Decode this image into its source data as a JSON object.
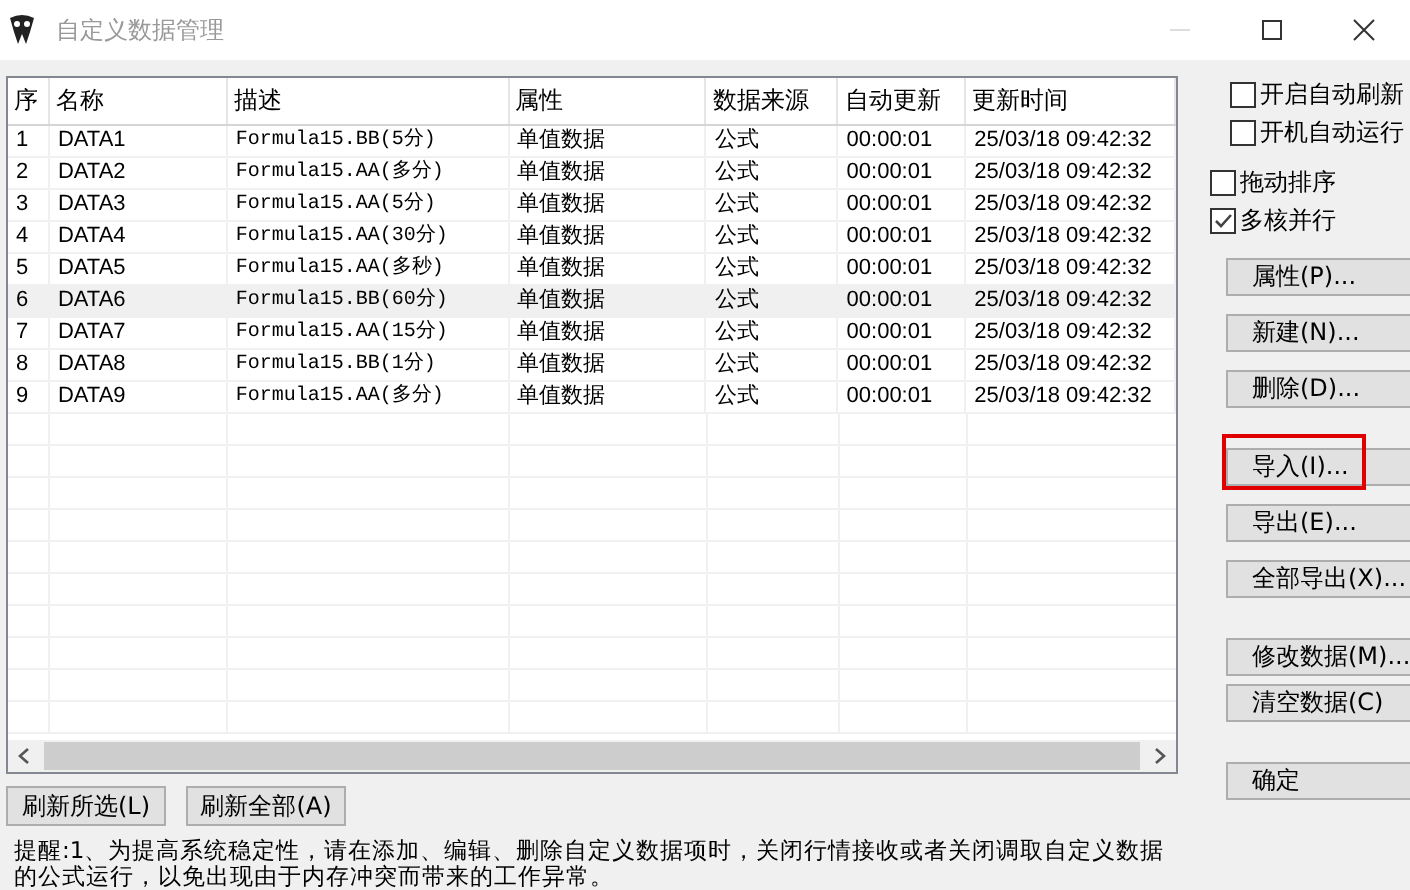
{
  "window": {
    "title": "自定义数据管理"
  },
  "table": {
    "columns": [
      "序",
      "名称",
      "描述",
      "属性",
      "数据来源",
      "自动更新",
      "更新时间"
    ],
    "rows": [
      {
        "cells": [
          "1",
          "DATA1",
          "Formula15.BB(5分)",
          "单值数据",
          "公式",
          "00:00:01",
          "25/03/18 09:42:32"
        ],
        "selected": false
      },
      {
        "cells": [
          "2",
          "DATA2",
          "Formula15.AA(多分)",
          "单值数据",
          "公式",
          "00:00:01",
          "25/03/18 09:42:32"
        ],
        "selected": false
      },
      {
        "cells": [
          "3",
          "DATA3",
          "Formula15.AA(5分)",
          "单值数据",
          "公式",
          "00:00:01",
          "25/03/18 09:42:32"
        ],
        "selected": false
      },
      {
        "cells": [
          "4",
          "DATA4",
          "Formula15.AA(30分)",
          "单值数据",
          "公式",
          "00:00:01",
          "25/03/18 09:42:32"
        ],
        "selected": false
      },
      {
        "cells": [
          "5",
          "DATA5",
          "Formula15.AA(多秒)",
          "单值数据",
          "公式",
          "00:00:01",
          "25/03/18 09:42:32"
        ],
        "selected": false
      },
      {
        "cells": [
          "6",
          "DATA6",
          "Formula15.BB(60分)",
          "单值数据",
          "公式",
          "00:00:01",
          "25/03/18 09:42:32"
        ],
        "selected": true
      },
      {
        "cells": [
          "7",
          "DATA7",
          "Formula15.AA(15分)",
          "单值数据",
          "公式",
          "00:00:01",
          "25/03/18 09:42:32"
        ],
        "selected": false
      },
      {
        "cells": [
          "8",
          "DATA8",
          "Formula15.BB(1分)",
          "单值数据",
          "公式",
          "00:00:01",
          "25/03/18 09:42:32"
        ],
        "selected": false
      },
      {
        "cells": [
          "9",
          "DATA9",
          "Formula15.AA(多分)",
          "单值数据",
          "公式",
          "00:00:01",
          "25/03/18 09:42:32"
        ],
        "selected": false
      }
    ]
  },
  "options": [
    {
      "label": "开启自动刷新",
      "checked": false
    },
    {
      "label": "开机自动运行",
      "checked": false
    },
    {
      "label": "拖动排序",
      "checked": false
    },
    {
      "label": "多核并行",
      "checked": true
    }
  ],
  "side_buttons": [
    {
      "label": "属性(P)...",
      "highlighted": false
    },
    {
      "label": "新建(N)...",
      "highlighted": false
    },
    {
      "label": "删除(D)...",
      "highlighted": false
    },
    {
      "label": "导入(I)...",
      "highlighted": true
    },
    {
      "label": "导出(E)...",
      "highlighted": false
    },
    {
      "label": "全部导出(X)...",
      "highlighted": false
    },
    {
      "label": "修改数据(M)...",
      "highlighted": false
    },
    {
      "label": "清空数据(C)",
      "highlighted": false
    },
    {
      "label": "确定",
      "highlighted": false
    }
  ],
  "bottom_buttons": [
    "刷新所选(L)",
    "刷新全部(A)"
  ],
  "note": "提醒:1、为提高系统稳定性，请在添加、编辑、删除自定义数据项时，关闭行情接收或者关闭调取自定义数据的公式运行，以免出现由于内存冲突而带来的工作异常。"
}
